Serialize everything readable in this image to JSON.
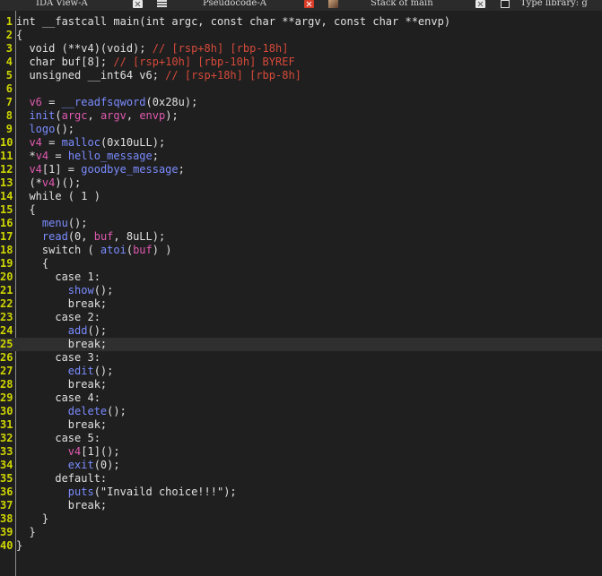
{
  "tabs": [
    {
      "label": "IDA View-A",
      "active": false,
      "icon": "grid-icon"
    },
    {
      "label": "Pseudocode-A",
      "active": true,
      "icon": "lock-icon"
    },
    {
      "label": "Stack of main",
      "active": false,
      "icon": "stack-icon"
    },
    {
      "label": "Type library: g",
      "active": false,
      "icon": "type-lib-icon"
    }
  ],
  "colors": {
    "background": "#1f1f1f",
    "line_numbers": "#cfd600",
    "text": "#e0e0e0",
    "variable": "#e05ab0",
    "function": "#7a8cff",
    "comment": "#d64a3a",
    "current_line": "#2f2f2f",
    "active_close": "#d93d28"
  },
  "editor": {
    "highlighted_line": 25,
    "lines": [
      {
        "n": "1",
        "t": [
          [
            "int __fastcall main(int argc, const char **argv, const char **envp)",
            "plain"
          ]
        ]
      },
      {
        "n": "2",
        "t": [
          [
            "{",
            "plain"
          ]
        ]
      },
      {
        "n": "3",
        "t": [
          [
            "  void (**v4)(void); ",
            "plain"
          ],
          [
            "// [rsp+8h] [rbp-18h]",
            "cmt"
          ]
        ]
      },
      {
        "n": "4",
        "t": [
          [
            "  char buf[8]; ",
            "plain"
          ],
          [
            "// [rsp+10h] [rbp-10h] BYREF",
            "cmt"
          ]
        ]
      },
      {
        "n": "5",
        "t": [
          [
            "  unsigned __int64 v6; ",
            "plain"
          ],
          [
            "// [rsp+18h] [rbp-8h]",
            "cmt"
          ]
        ]
      },
      {
        "n": "6",
        "t": []
      },
      {
        "n": "7",
        "t": [
          [
            "  ",
            "plain"
          ],
          [
            "v6",
            "var"
          ],
          [
            " = ",
            "plain"
          ],
          [
            "__readfsqword",
            "func"
          ],
          [
            "(0x28u);",
            "plain"
          ]
        ]
      },
      {
        "n": "8",
        "t": [
          [
            "  ",
            "plain"
          ],
          [
            "init",
            "func"
          ],
          [
            "(",
            "plain"
          ],
          [
            "argc",
            "var"
          ],
          [
            ", ",
            "plain"
          ],
          [
            "argv",
            "var"
          ],
          [
            ", ",
            "plain"
          ],
          [
            "envp",
            "var"
          ],
          [
            ");",
            "plain"
          ]
        ]
      },
      {
        "n": "9",
        "t": [
          [
            "  ",
            "plain"
          ],
          [
            "logo",
            "func"
          ],
          [
            "();",
            "plain"
          ]
        ]
      },
      {
        "n": "10",
        "t": [
          [
            "  ",
            "plain"
          ],
          [
            "v4",
            "var"
          ],
          [
            " = ",
            "plain"
          ],
          [
            "malloc",
            "func"
          ],
          [
            "(0x10uLL);",
            "plain"
          ]
        ]
      },
      {
        "n": "11",
        "t": [
          [
            "  *",
            "plain"
          ],
          [
            "v4",
            "var"
          ],
          [
            " = ",
            "plain"
          ],
          [
            "hello_message",
            "func"
          ],
          [
            ";",
            "plain"
          ]
        ]
      },
      {
        "n": "12",
        "t": [
          [
            "  ",
            "plain"
          ],
          [
            "v4",
            "var"
          ],
          [
            "[1] = ",
            "plain"
          ],
          [
            "goodbye_message",
            "func"
          ],
          [
            ";",
            "plain"
          ]
        ]
      },
      {
        "n": "13",
        "t": [
          [
            "  (*",
            "plain"
          ],
          [
            "v4",
            "var"
          ],
          [
            ")();",
            "plain"
          ]
        ]
      },
      {
        "n": "14",
        "t": [
          [
            "  while ( 1 )",
            "plain"
          ]
        ]
      },
      {
        "n": "15",
        "t": [
          [
            "  {",
            "plain"
          ]
        ]
      },
      {
        "n": "16",
        "t": [
          [
            "    ",
            "plain"
          ],
          [
            "menu",
            "func"
          ],
          [
            "();",
            "plain"
          ]
        ]
      },
      {
        "n": "17",
        "t": [
          [
            "    ",
            "plain"
          ],
          [
            "read",
            "func"
          ],
          [
            "(0, ",
            "plain"
          ],
          [
            "buf",
            "var"
          ],
          [
            ", 8uLL);",
            "plain"
          ]
        ]
      },
      {
        "n": "18",
        "t": [
          [
            "    switch ( ",
            "plain"
          ],
          [
            "atoi",
            "func"
          ],
          [
            "(",
            "plain"
          ],
          [
            "buf",
            "var"
          ],
          [
            ") )",
            "plain"
          ]
        ]
      },
      {
        "n": "19",
        "t": [
          [
            "    {",
            "plain"
          ]
        ]
      },
      {
        "n": "20",
        "t": [
          [
            "      case 1:",
            "plain"
          ]
        ]
      },
      {
        "n": "21",
        "t": [
          [
            "        ",
            "plain"
          ],
          [
            "show",
            "func"
          ],
          [
            "();",
            "plain"
          ]
        ]
      },
      {
        "n": "22",
        "t": [
          [
            "        break;",
            "plain"
          ]
        ]
      },
      {
        "n": "23",
        "t": [
          [
            "      case 2:",
            "plain"
          ]
        ]
      },
      {
        "n": "24",
        "t": [
          [
            "        ",
            "plain"
          ],
          [
            "add",
            "func"
          ],
          [
            "();",
            "plain"
          ]
        ]
      },
      {
        "n": "25",
        "t": [
          [
            "        break;",
            "plain"
          ]
        ]
      },
      {
        "n": "26",
        "t": [
          [
            "      case 3:",
            "plain"
          ]
        ]
      },
      {
        "n": "27",
        "t": [
          [
            "        ",
            "plain"
          ],
          [
            "edit",
            "func"
          ],
          [
            "();",
            "plain"
          ]
        ]
      },
      {
        "n": "28",
        "t": [
          [
            "        break;",
            "plain"
          ]
        ]
      },
      {
        "n": "29",
        "t": [
          [
            "      case 4:",
            "plain"
          ]
        ]
      },
      {
        "n": "30",
        "t": [
          [
            "        ",
            "plain"
          ],
          [
            "delete",
            "func"
          ],
          [
            "();",
            "plain"
          ]
        ]
      },
      {
        "n": "31",
        "t": [
          [
            "        break;",
            "plain"
          ]
        ]
      },
      {
        "n": "32",
        "t": [
          [
            "      case 5:",
            "plain"
          ]
        ]
      },
      {
        "n": "33",
        "t": [
          [
            "        ",
            "plain"
          ],
          [
            "v4",
            "var"
          ],
          [
            "[1]();",
            "plain"
          ]
        ]
      },
      {
        "n": "34",
        "t": [
          [
            "        ",
            "plain"
          ],
          [
            "exit",
            "func"
          ],
          [
            "(0);",
            "plain"
          ]
        ]
      },
      {
        "n": "35",
        "t": [
          [
            "      default:",
            "plain"
          ]
        ]
      },
      {
        "n": "36",
        "t": [
          [
            "        ",
            "plain"
          ],
          [
            "puts",
            "func"
          ],
          [
            "(\"Invaild choice!!!\");",
            "plain"
          ]
        ]
      },
      {
        "n": "37",
        "t": [
          [
            "        break;",
            "plain"
          ]
        ]
      },
      {
        "n": "38",
        "t": [
          [
            "    }",
            "plain"
          ]
        ]
      },
      {
        "n": "39",
        "t": [
          [
            "  }",
            "plain"
          ]
        ]
      },
      {
        "n": "40",
        "t": [
          [
            "}",
            "plain"
          ]
        ]
      }
    ]
  }
}
